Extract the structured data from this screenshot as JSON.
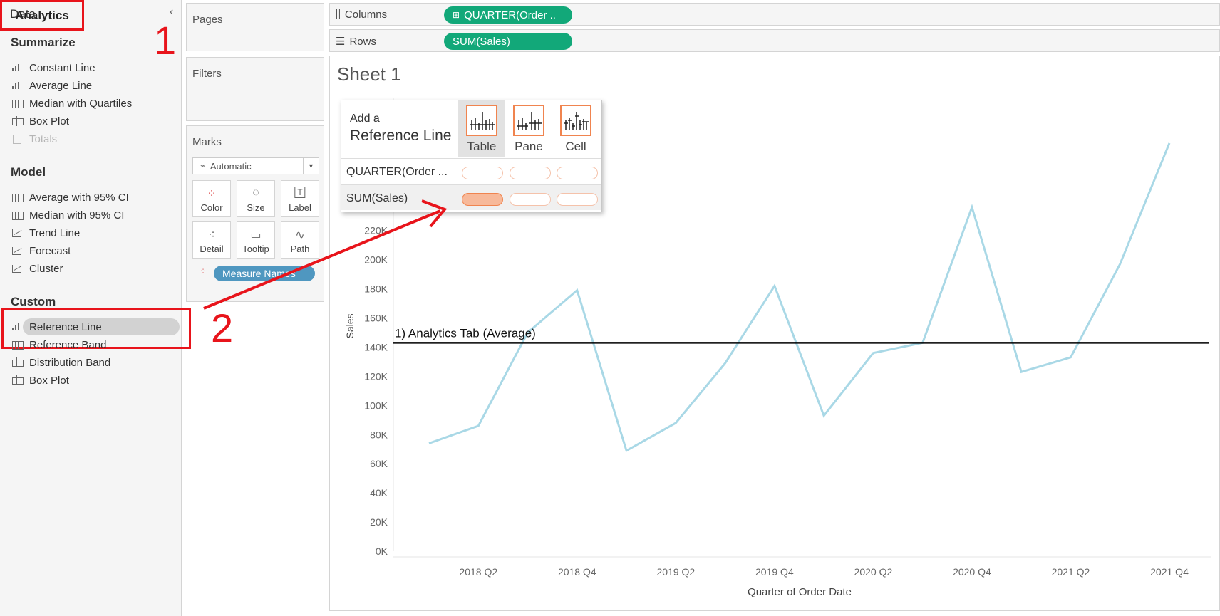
{
  "left_pane": {
    "tabs": [
      "Data",
      "Analytics"
    ],
    "sections": [
      {
        "title": "Summarize",
        "items": [
          {
            "label": "Constant Line",
            "icon": "bar-marker-icon",
            "enabled": true
          },
          {
            "label": "Average Line",
            "icon": "bar-marker-icon",
            "enabled": true
          },
          {
            "label": "Median with Quartiles",
            "icon": "grid-icon",
            "enabled": true
          },
          {
            "label": "Box Plot",
            "icon": "box-plot-icon",
            "enabled": true
          },
          {
            "label": "Totals",
            "icon": "totals-icon",
            "enabled": false
          }
        ]
      },
      {
        "title": "Model",
        "items": [
          {
            "label": "Average with 95% CI",
            "icon": "grid-icon",
            "enabled": true
          },
          {
            "label": "Median with 95% CI",
            "icon": "grid-icon",
            "enabled": true
          },
          {
            "label": "Trend Line",
            "icon": "trend-icon",
            "enabled": true
          },
          {
            "label": "Forecast",
            "icon": "trend-icon",
            "enabled": true
          },
          {
            "label": "Cluster",
            "icon": "trend-icon",
            "enabled": true
          }
        ]
      },
      {
        "title": "Custom",
        "items": [
          {
            "label": "Reference Line",
            "icon": "bar-marker-icon",
            "enabled": true
          },
          {
            "label": "Reference Band",
            "icon": "grid-icon",
            "enabled": true
          },
          {
            "label": "Distribution Band",
            "icon": "box-plot-icon",
            "enabled": true
          },
          {
            "label": "Box Plot",
            "icon": "box-plot-icon",
            "enabled": true
          }
        ]
      }
    ]
  },
  "annotations": {
    "step1": "1",
    "step2": "2",
    "color": "#e8141b"
  },
  "cards": {
    "pages": "Pages",
    "filters": "Filters",
    "marks": "Marks",
    "mark_type": "Automatic",
    "mark_buttons": [
      "Color",
      "Size",
      "Label",
      "Detail",
      "Tooltip",
      "Path"
    ],
    "measure_pill": "Measure Names"
  },
  "shelves": {
    "columns_label": "Columns",
    "columns_pill": "QUARTER(Order ..",
    "rows_label": "Rows",
    "rows_pill": "SUM(Sales)"
  },
  "sheet_title": "Sheet 1",
  "popup": {
    "head1": "Add a",
    "head2": "Reference Line",
    "scopes": [
      "Table",
      "Pane",
      "Cell"
    ],
    "rows": [
      "QUARTER(Order ...",
      "SUM(Sales)"
    ]
  },
  "chart_data": {
    "type": "line",
    "xlabel": "Quarter of Order Date",
    "ylabel": "Sales",
    "x": [
      "2018 Q1",
      "2018 Q2",
      "2018 Q3",
      "2018 Q4",
      "2019 Q1",
      "2019 Q2",
      "2019 Q3",
      "2019 Q4",
      "2020 Q1",
      "2020 Q2",
      "2020 Q3",
      "2020 Q4",
      "2021 Q1",
      "2021 Q2",
      "2021 Q3",
      "2021 Q4"
    ],
    "x_tick_labels": [
      "2018 Q2",
      "2018 Q4",
      "2019 Q2",
      "2019 Q4",
      "2020 Q2",
      "2020 Q4",
      "2021 Q2",
      "2021 Q4"
    ],
    "series": [
      {
        "values": [
          74000,
          86000,
          150000,
          179000,
          69000,
          88000,
          129000,
          182000,
          93000,
          136000,
          143000,
          236000,
          123000,
          133000,
          197000,
          280000
        ],
        "color": "#a9d8e6"
      }
    ],
    "reference_line": {
      "value": 143000,
      "label": "1) Analytics Tab (Average)",
      "color": "#000000"
    },
    "y_ticks": [
      0,
      20000,
      40000,
      60000,
      80000,
      100000,
      120000,
      140000,
      160000,
      180000,
      200000,
      220000
    ],
    "y_tick_labels": [
      "0K",
      "20K",
      "40K",
      "60K",
      "80K",
      "100K",
      "120K",
      "140K",
      "160K",
      "180K",
      "200K",
      "220K"
    ],
    "ylim": [
      0,
      300000
    ]
  }
}
